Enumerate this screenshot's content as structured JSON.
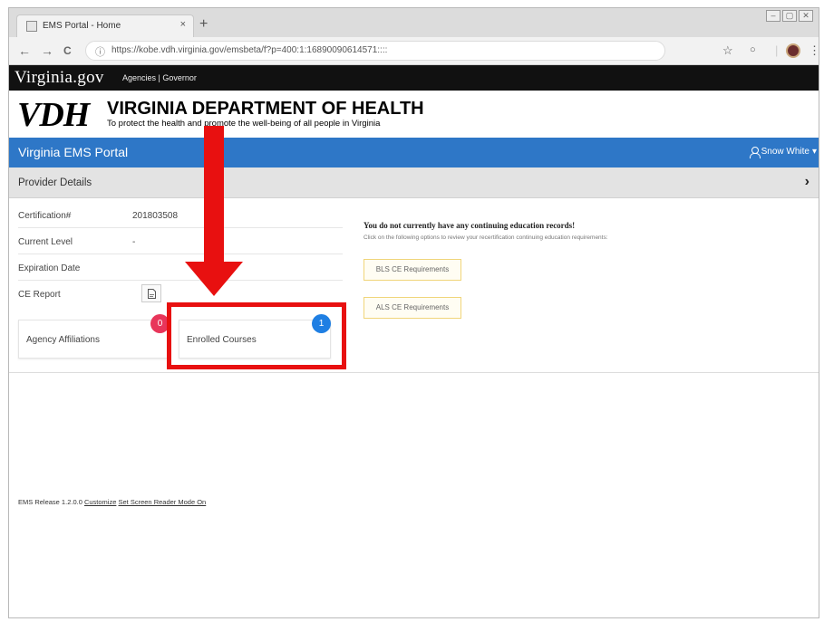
{
  "browser": {
    "tab_title": "EMS Portal - Home",
    "tab_close": "×",
    "new_tab": "+",
    "url": "https://kobe.vdh.virginia.gov/emsbeta/f?p=400:1:16890090614571::::",
    "back": "←",
    "forward": "→",
    "reload": "C",
    "info": "ⓘ",
    "star": "☆",
    "menu": "⋮",
    "window_controls": [
      "–",
      "▢",
      "✕"
    ]
  },
  "gov_bar": {
    "logo": "Virginia.gov",
    "links": "Agencies | Governor"
  },
  "vdh_header": {
    "mark": "VDH",
    "department": "VIRGINIA DEPARTMENT OF HEALTH",
    "tagline": "To protect the health and promote the well-being of all people in Virginia"
  },
  "portal_bar": {
    "name": "Virginia EMS Portal",
    "user": "Snow White",
    "user_caret": "▾"
  },
  "provider": {
    "title": "Provider Details",
    "chevron": "›"
  },
  "details": [
    {
      "label": "Certification#",
      "value": "201803508"
    },
    {
      "label": "Current Level",
      "value": "-"
    },
    {
      "label": "Expiration Date",
      "value": ""
    },
    {
      "label": "CE Report",
      "value": ""
    }
  ],
  "cards": {
    "agency": {
      "label": "Agency Affiliations",
      "count": "0",
      "color": "#e8355a"
    },
    "courses": {
      "label": "Enrolled Courses",
      "count": "1",
      "color": "#1f7fe3"
    }
  },
  "ce": {
    "title": "You do not currently have any continuing education records!",
    "text": "Click on the following options to review your recertification continuing education requirements:",
    "bls_button": "BLS CE Requirements",
    "als_button": "ALS CE Requirements"
  },
  "footer": {
    "release": "EMS Release 1.2.0.0",
    "customize": "Customize",
    "reader_mode": "Set Screen Reader Mode On"
  },
  "annotation_color": "#e81010"
}
